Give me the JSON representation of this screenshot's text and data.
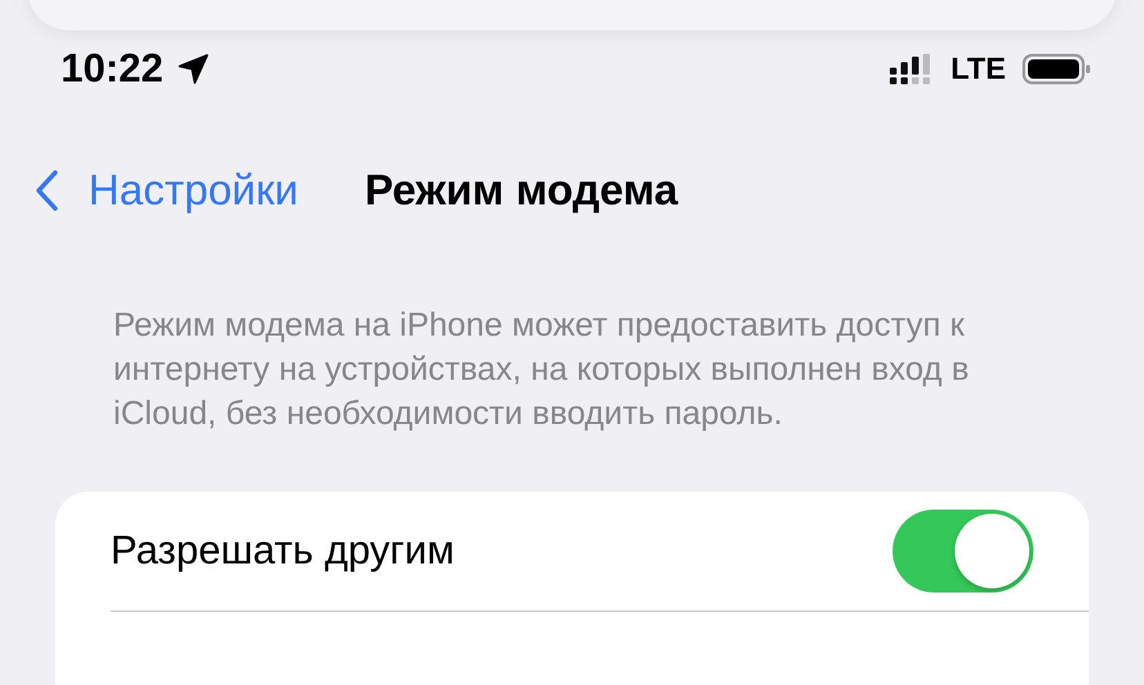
{
  "status_bar": {
    "time": "10:22",
    "network": "LTE"
  },
  "nav": {
    "back": "Настройки",
    "title": "Режим модема"
  },
  "description": "Режим модема на iPhone может предоставить доступ к интернету на устройствах, на которых выполнен вход в iCloud, без необходимости вводить пароль.",
  "rows": [
    {
      "label": "Разрешать другим",
      "on": true
    }
  ]
}
